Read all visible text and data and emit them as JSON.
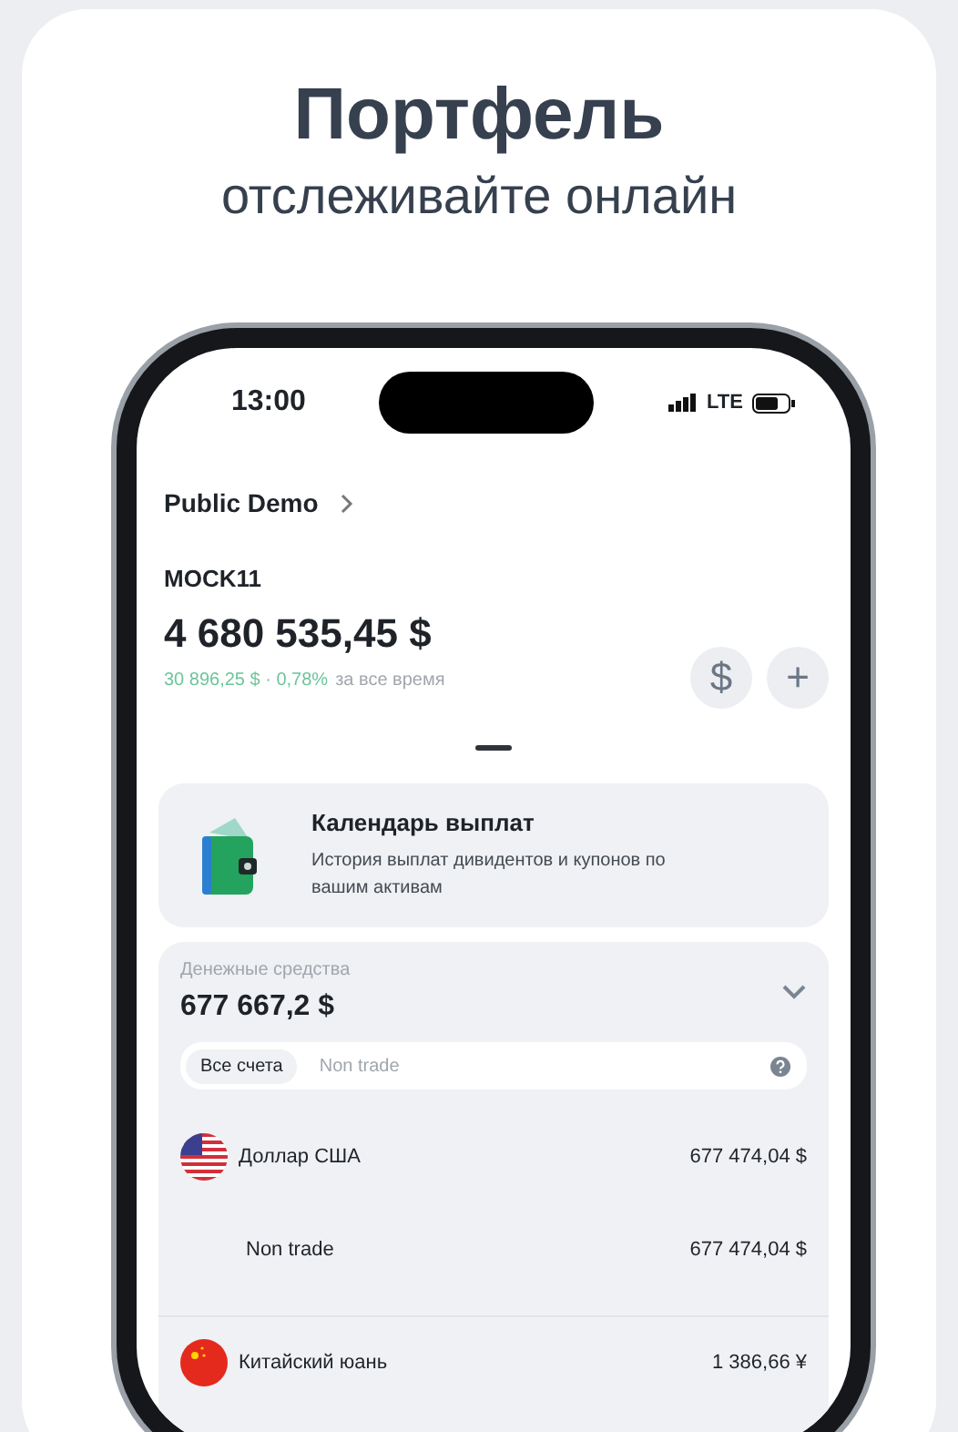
{
  "promo": {
    "title": "Портфель",
    "subtitle": "отслеживайте онлайн"
  },
  "status_bar": {
    "time": "13:00",
    "network": "LTE"
  },
  "account_selector": {
    "label": "Public Demo"
  },
  "portfolio": {
    "name": "MOCK11",
    "balance": "4 680 535,45 $",
    "change": "30 896,25 $ · 0,78%",
    "period": "за все время"
  },
  "action_buttons": [
    {
      "label": "$"
    },
    {
      "label": "+"
    }
  ],
  "calendar_card": {
    "title": "Календарь выплат",
    "description": "История выплат дивидентов и купонов по вашим активам"
  },
  "cash": {
    "label": "Денежные средства",
    "amount": "677 667,2 $",
    "tabs": [
      {
        "label": "Все счета",
        "selected": true
      },
      {
        "label": "Non trade",
        "selected": false
      }
    ],
    "currencies": [
      {
        "name": "Доллар США",
        "amount": "677 474,04 $",
        "kind": "us",
        "accounts": [
          {
            "name": "Non trade",
            "amount": "677 474,04 $"
          }
        ]
      },
      {
        "name": "Китайский юань",
        "amount": "1 386,66 ¥",
        "kind": "cn"
      }
    ]
  }
}
